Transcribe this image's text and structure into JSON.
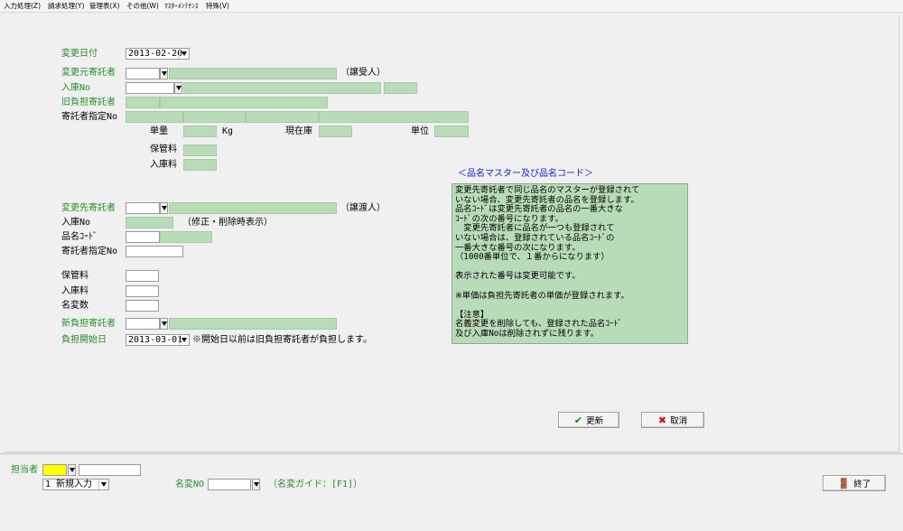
{
  "menu": [
    "入力処理(Z)",
    "請求処理(Y)",
    "管理表(X)",
    "その他(W)",
    "ﾏｽﾀｰﾒﾝﾃﾅﾝｽ",
    "特殊(V)"
  ],
  "form": {
    "change_date_label": "変更日付",
    "change_date_value": "2013-02-20",
    "source_consignor_label": "変更元寄託者",
    "source_consignor_suffix": "（譲受人）",
    "receipt_no_label": "入庫No",
    "old_payer_label": "旧負担寄託者",
    "designated_label": "寄託者指定No",
    "unit_weight_label": "単量",
    "kg_label": "Kg",
    "stock_label": "現在庫",
    "unit_label": "単位",
    "storage_fee_label": "保管料",
    "receipt_fee_label": "入庫料",
    "dest_consignor_label": "変更先寄託者",
    "dest_consignor_suffix": "（譲渡人）",
    "dest_receipt_no_label": "入庫No",
    "dest_receipt_note": "（修正・削除時表示）",
    "product_code_label": "品名ｺｰﾄﾞ",
    "dest_designated_label": "寄託者指定No",
    "dest_storage_fee_label": "保管料",
    "dest_receipt_fee_label": "入庫料",
    "name_change_count_label": "名変数",
    "new_payer_label": "新負担寄託者",
    "start_date_label": "負担開始日",
    "start_date_value": "2013-03-01",
    "start_date_note": "※開始日以前は旧負担寄託者が負担します。"
  },
  "info": {
    "title": "＜品名マスター及び品名コード＞",
    "text": "変更先寄託者で同じ品名のマスターが登録されて\nいない場合、変更先寄託者の品名を登録します。\n品名ｺｰﾄﾞは変更先寄託者の品名の一番大きな\nｺｰﾄﾞの次の番号になります。\n　変更先寄託者に品名が一つも登録されて\nいない場合は、登録されている品名ｺｰﾄﾞの\n一番大きな番号の次になります。\n（1000番単位で、１番からになります）\n\n表示された番号は変更可能です。\n\n※単価は負担先寄託者の単価が登録されます。\n\n【注意】\n名義変更を削除しても、登録された品名ｺｰﾄﾞ\n及び入庫Noは削除されずに残ります。"
  },
  "buttons": {
    "update": "更新",
    "cancel": "取消",
    "exit": "終了"
  },
  "footer": {
    "staff_label": "担当者",
    "mode_value": "1 新規入力",
    "name_change_no_label": "名変NO",
    "guide_text": "（名変ガイド：[F1]）"
  },
  "colors": {
    "field_green": "#b8dcb8",
    "label_green": "#2a8a2a",
    "title_blue": "#1a1acc",
    "staff_yellow": "#ffff00"
  }
}
